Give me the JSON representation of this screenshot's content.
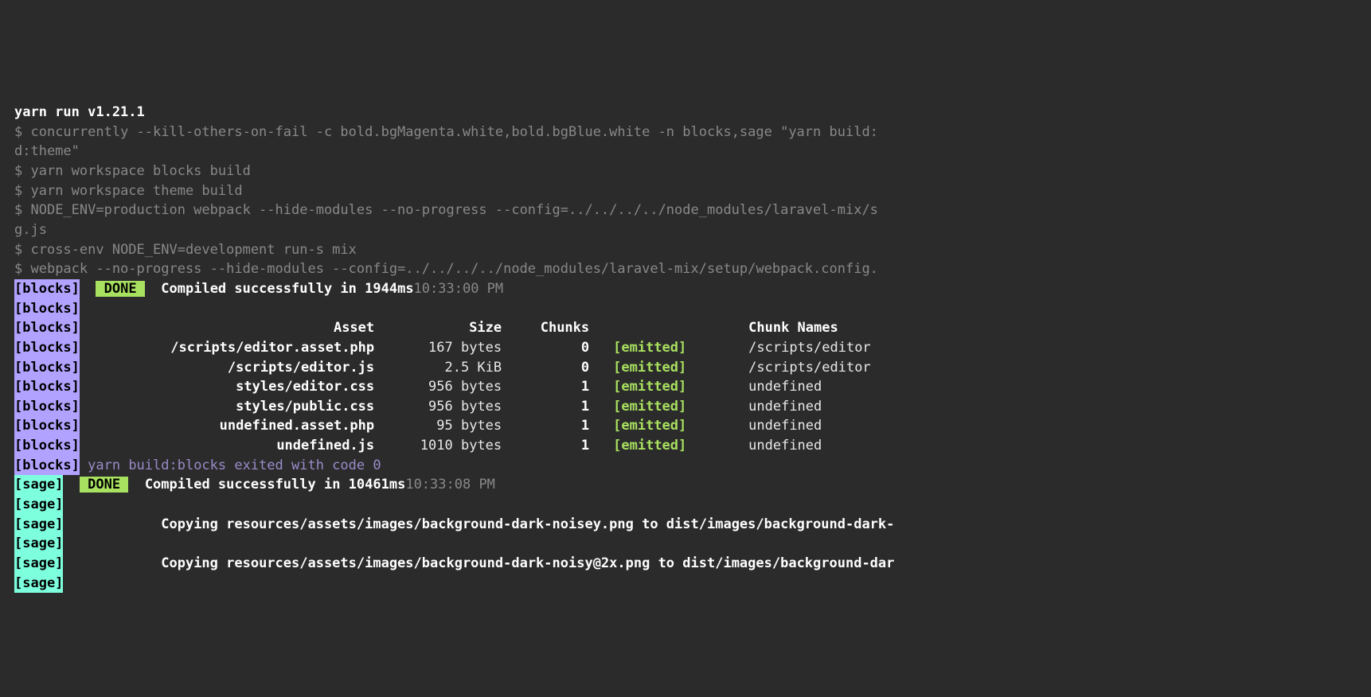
{
  "header": "yarn run v1.21.1",
  "prompt": "$ ",
  "commands": {
    "c1": "concurrently --kill-others-on-fail -c bold.bgMagenta.white,bold.bgBlue.white -n blocks,sage \"yarn build:",
    "c1b": "d:theme\"",
    "c2": "yarn workspace blocks build",
    "c3": "yarn workspace theme build",
    "c4": "NODE_ENV=production webpack --hide-modules --no-progress --config=../../../../node_modules/laravel-mix/s",
    "c4b": "g.js",
    "c5": "cross-env NODE_ENV=development run-s mix",
    "c6": "webpack --no-progress --hide-modules --config=../../../../node_modules/laravel-mix/setup/webpack.config."
  },
  "tags": {
    "blocks": "[blocks]",
    "sage": "[sage]"
  },
  "done": " DONE ",
  "compiled": {
    "blocks": "Compiled successfully in 1944ms",
    "blocks_time": "10:33:00 PM",
    "sage": "Compiled successfully in 10461ms",
    "sage_time": "10:33:08 PM"
  },
  "table": {
    "headers": {
      "asset": "Asset",
      "size": "Size",
      "chunks": "Chunks",
      "names": "Chunk Names"
    },
    "emitted": "[emitted]",
    "rows": [
      {
        "asset": "/scripts/editor.asset.php",
        "size": "167 bytes",
        "chunks": "0",
        "name": "/scripts/editor"
      },
      {
        "asset": "/scripts/editor.js",
        "size": "2.5 KiB",
        "chunks": "0",
        "name": "/scripts/editor"
      },
      {
        "asset": "styles/editor.css",
        "size": "956 bytes",
        "chunks": "1",
        "name": "undefined"
      },
      {
        "asset": "styles/public.css",
        "size": "956 bytes",
        "chunks": "1",
        "name": "undefined"
      },
      {
        "asset": "undefined.asset.php",
        "size": "95 bytes",
        "chunks": "1",
        "name": "undefined"
      },
      {
        "asset": "undefined.js",
        "size": "1010 bytes",
        "chunks": "1",
        "name": "undefined"
      }
    ]
  },
  "exit_line": "yarn build:blocks exited with code 0",
  "copying": {
    "line1": "Copying resources/assets/images/background-dark-noisey.png to dist/images/background-dark-",
    "line2": "Copying resources/assets/images/background-dark-noisy@2x.png to dist/images/background-dar"
  }
}
